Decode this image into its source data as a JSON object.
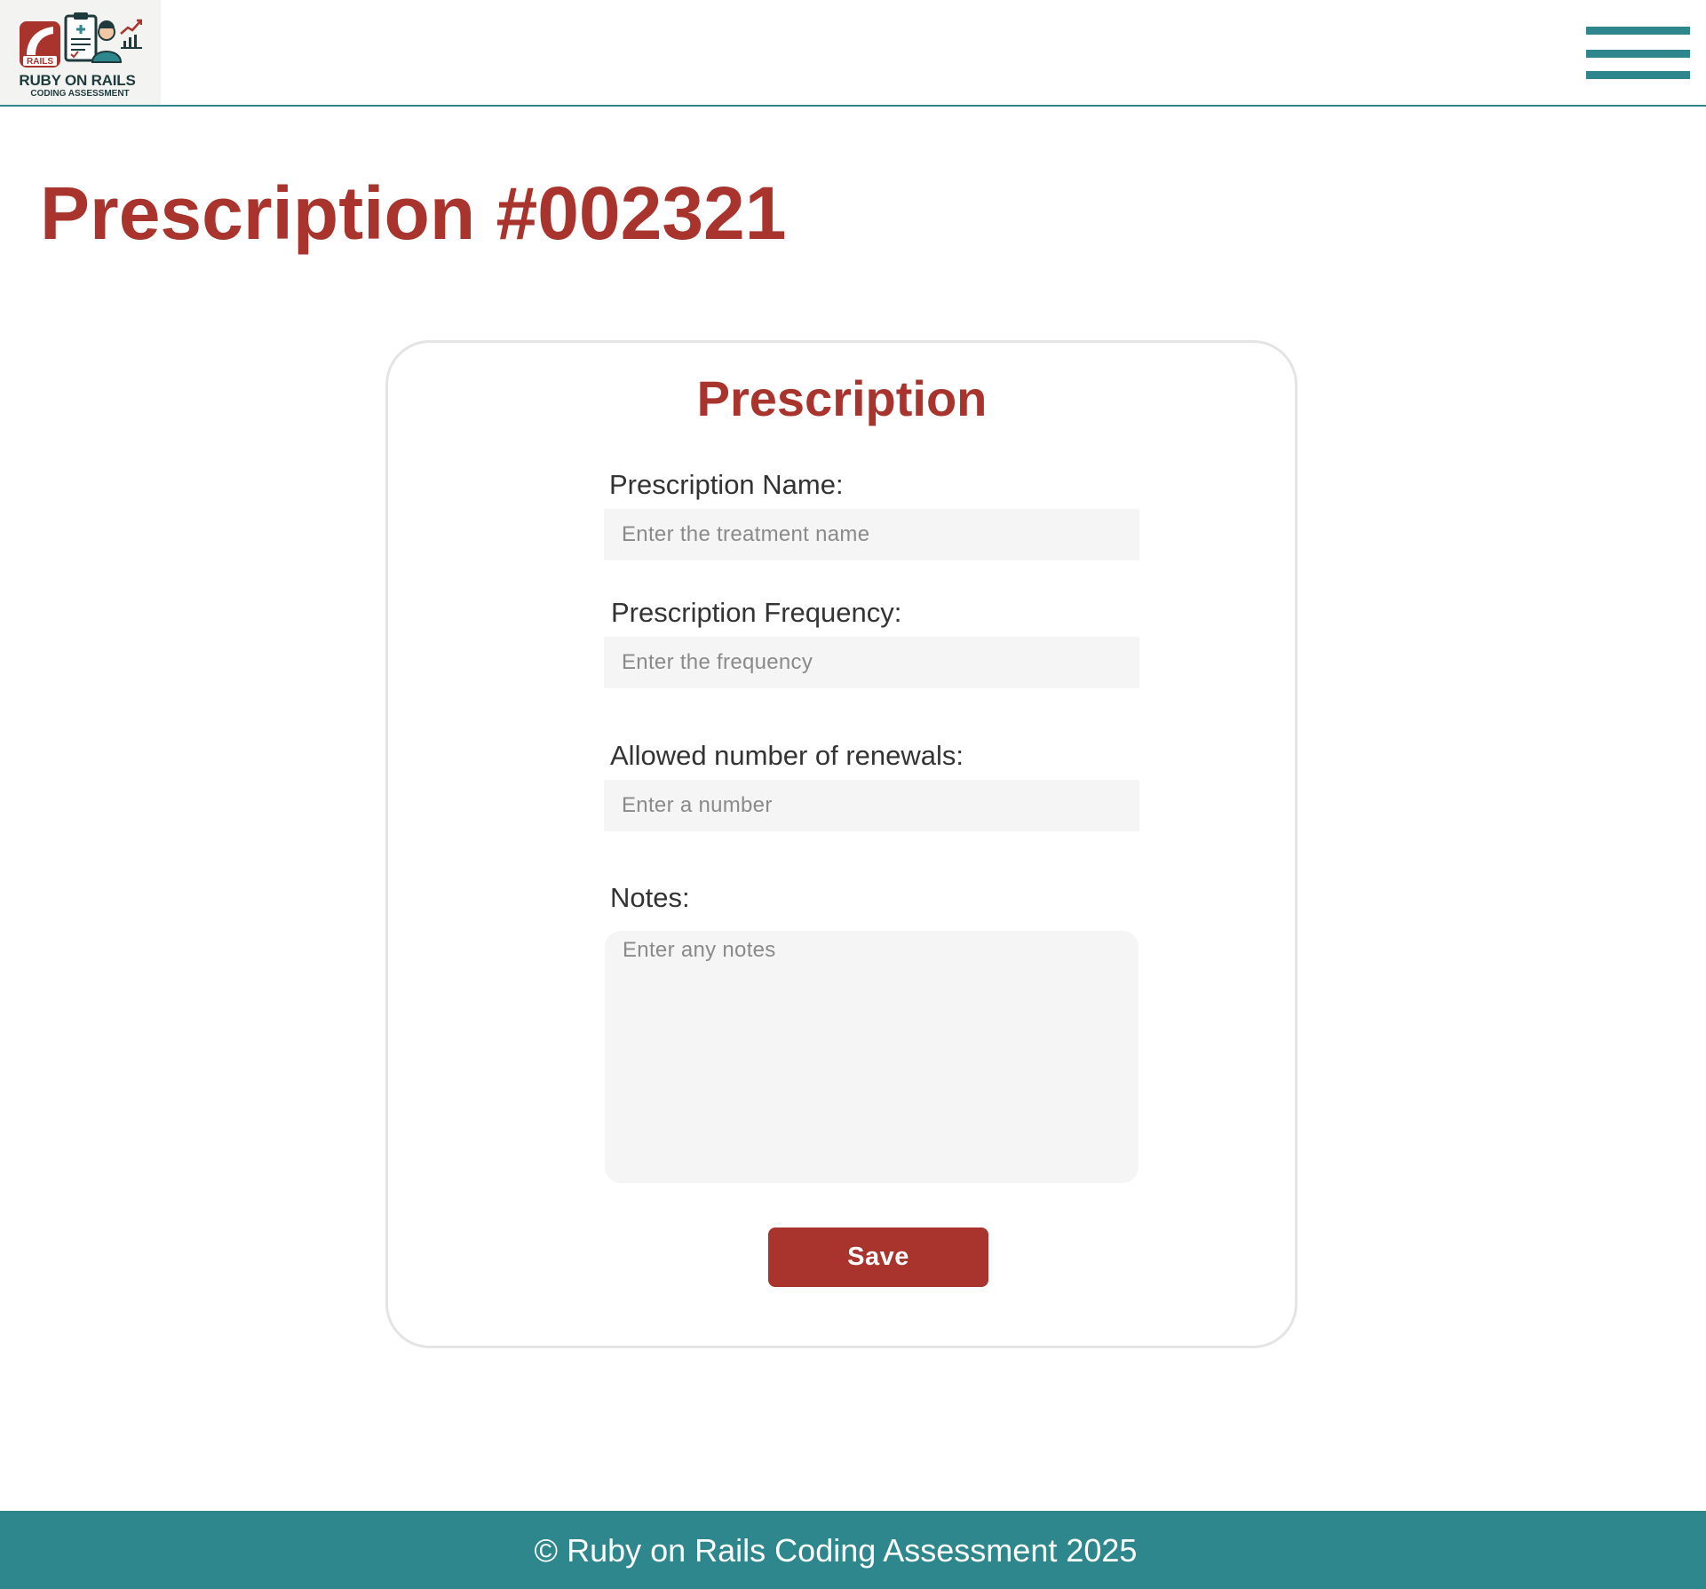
{
  "header": {
    "logo": {
      "badge_text": "RAILS",
      "title": "RUBY ON RAILS",
      "subtitle": "CODING ASSESSMENT",
      "icons": [
        "rails-icon",
        "clipboard-icon",
        "doctor-icon",
        "chart-icon"
      ]
    },
    "menu_icon": "hamburger-menu-icon"
  },
  "page": {
    "title": "Prescription #002321"
  },
  "form": {
    "title": "Prescription",
    "name": {
      "label": "Prescription Name:",
      "placeholder": "Enter the treatment name",
      "value": ""
    },
    "frequency": {
      "label": "Prescription Frequency:",
      "placeholder": "Enter the frequency",
      "value": ""
    },
    "renewals": {
      "label": "Allowed number of renewals:",
      "placeholder": "Enter a number",
      "value": ""
    },
    "notes": {
      "label": "Notes:",
      "placeholder": "Enter any notes",
      "value": ""
    },
    "save_label": "Save"
  },
  "footer": {
    "text": "© Ruby on Rails Coding Assessment 2025"
  },
  "colors": {
    "brand_red": "#a8342d",
    "teal": "#2e878c",
    "input_bg": "#f5f5f5",
    "card_border": "#e4e4e4"
  }
}
